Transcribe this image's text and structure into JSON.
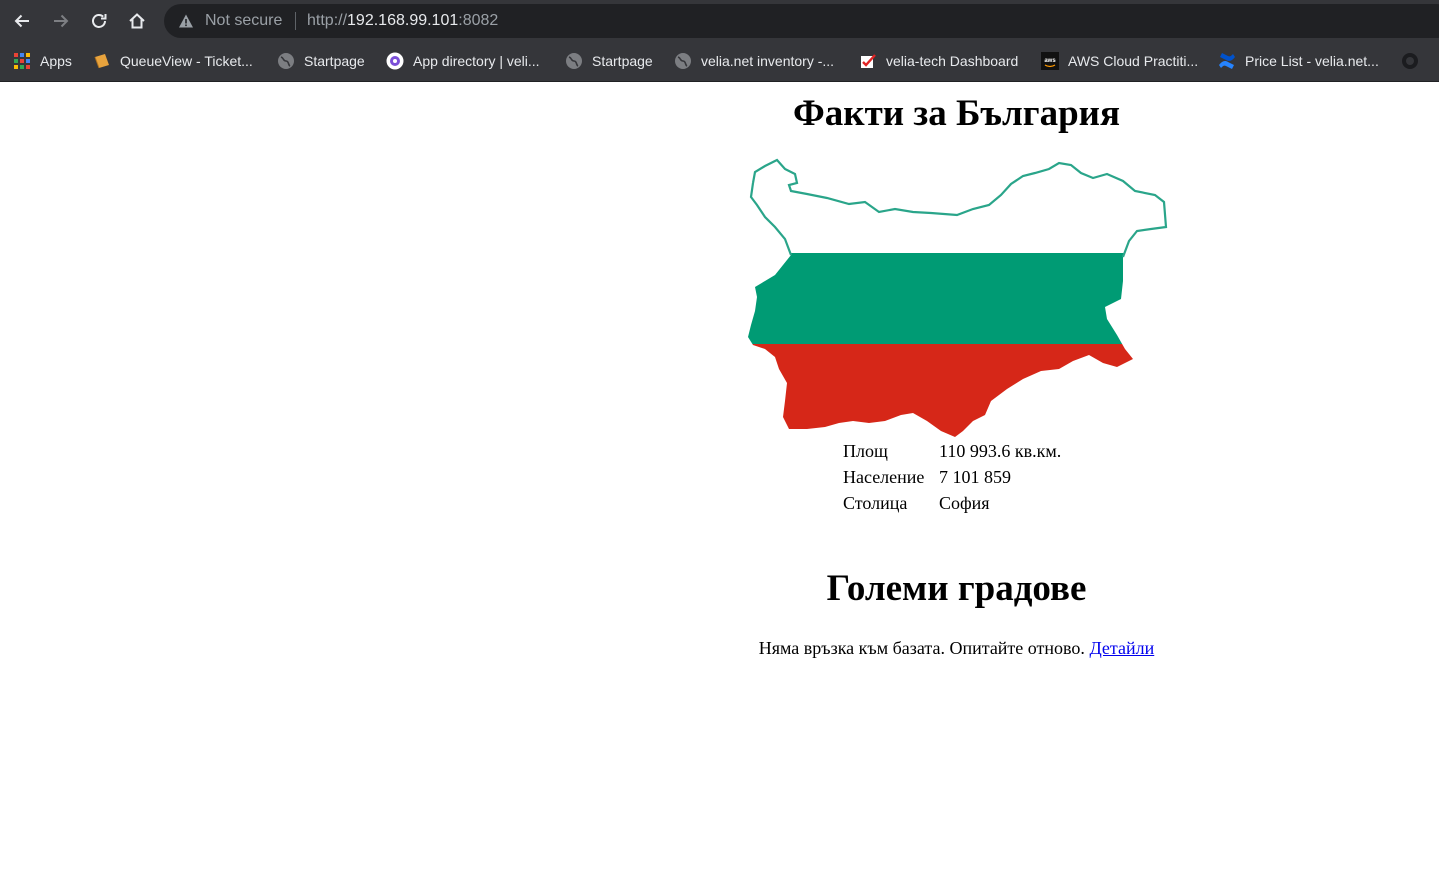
{
  "browser": {
    "omnibox": {
      "security_label": "Not secure",
      "url_scheme": "http://",
      "url_host": "192.168.99.101",
      "url_port": ":8082"
    },
    "bookmarks": [
      {
        "label": "Apps",
        "icon": "apps-grid-icon"
      },
      {
        "label": "QueueView - Ticket...",
        "icon": "queueview-icon"
      },
      {
        "label": "Startpage",
        "icon": "globe-icon"
      },
      {
        "label": "App directory | veli...",
        "icon": "app-directory-icon"
      },
      {
        "label": "Startpage",
        "icon": "globe-icon"
      },
      {
        "label": "velia.net inventory -...",
        "icon": "globe-icon"
      },
      {
        "label": "velia-tech Dashboard",
        "icon": "dashboard-icon"
      },
      {
        "label": "AWS Cloud Practiti...",
        "icon": "aws-icon"
      },
      {
        "label": "Price List - velia.net...",
        "icon": "confluence-icon"
      }
    ]
  },
  "page": {
    "title": "Факти за България",
    "facts": [
      {
        "label": "Площ",
        "value": "110 993.6 кв.км."
      },
      {
        "label": "Население",
        "value": "7 101 859"
      },
      {
        "label": "Столица",
        "value": "София"
      }
    ],
    "cities_title": "Големи градове",
    "error_text": "Няма връзка към базата. Опитайте отново.",
    "error_link": "Детайли"
  },
  "colors": {
    "flag_white": "#ffffff",
    "flag_green": "#009b74",
    "flag_red": "#d62718",
    "map_outline": "#2aa58a",
    "link": "#0000ee"
  }
}
